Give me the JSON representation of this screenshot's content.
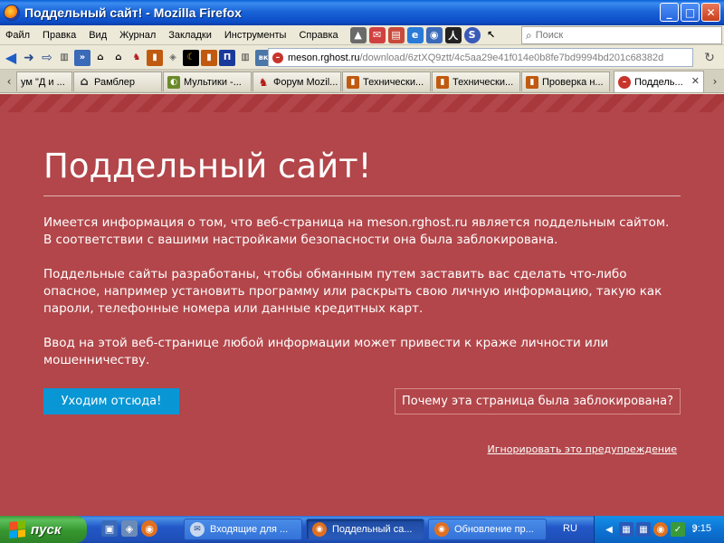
{
  "window": {
    "title": "Поддельный сайт! - Mozilla Firefox",
    "minimize": "_",
    "maximize": "□",
    "close": "✕"
  },
  "menu": {
    "items": [
      "Файл",
      "Правка",
      "Вид",
      "Журнал",
      "Закладки",
      "Инструменты",
      "Справка"
    ],
    "search_placeholder": "Поиск"
  },
  "navbar": {
    "url_host": "meson.rghost.ru",
    "url_path": "/download/6ztXQ9ztt/4c5aa29e41f014e0b8fe7bd9994bd201c68382d",
    "bookmark_vk": "вк"
  },
  "tabs": [
    {
      "label": "ум \"Д и ...",
      "icon_color": "#888888"
    },
    {
      "label": "Рамблер",
      "icon_color": "#333333"
    },
    {
      "label": "Мультики -...",
      "icon_color": "#6a8a2a"
    },
    {
      "label": "Форум Mozil...",
      "icon_color": "#b01818"
    },
    {
      "label": "Технически...",
      "icon_color": "#c05a10"
    },
    {
      "label": "Технически...",
      "icon_color": "#c05a10"
    },
    {
      "label": "Проверка н...",
      "icon_color": "#c05a10"
    },
    {
      "label": "Поддель...",
      "icon_color": "#c8342a"
    }
  ],
  "warning": {
    "heading": "Поддельный сайт!",
    "paragraph1": "Имеется информация о том, что веб-страница на meson.rghost.ru является поддельным сайтом. В соответствии с вашими настройками безопасности она была заблокирована.",
    "paragraph2": "Поддельные сайты разработаны, чтобы обманным путем заставить вас сделать что-либо опасное, например установить программу или раскрыть свою личную информацию, такую как пароли, телефонные номера или данные кредитных карт.",
    "paragraph3": "Ввод на этой веб-странице любой информации может привести к краже личности или мошенничеству.",
    "leave_button": "Уходим отсюда!",
    "why_button": "Почему эта страница была заблокирована?",
    "ignore_link": "Игнорировать это предупреждение"
  },
  "taskbar": {
    "start_label": "пуск",
    "tasks": [
      {
        "label": "Входящие для ...",
        "active": false
      },
      {
        "label": "Поддельный са...",
        "active": true
      },
      {
        "label": "Обновление пр...",
        "active": false
      }
    ],
    "language": "RU",
    "clock": "9:15"
  },
  "colors": {
    "warning_bg": "#b2464a",
    "leave_button": "#0996d4",
    "titlebar": "#0c4ec8",
    "start_button": "#36962e"
  }
}
